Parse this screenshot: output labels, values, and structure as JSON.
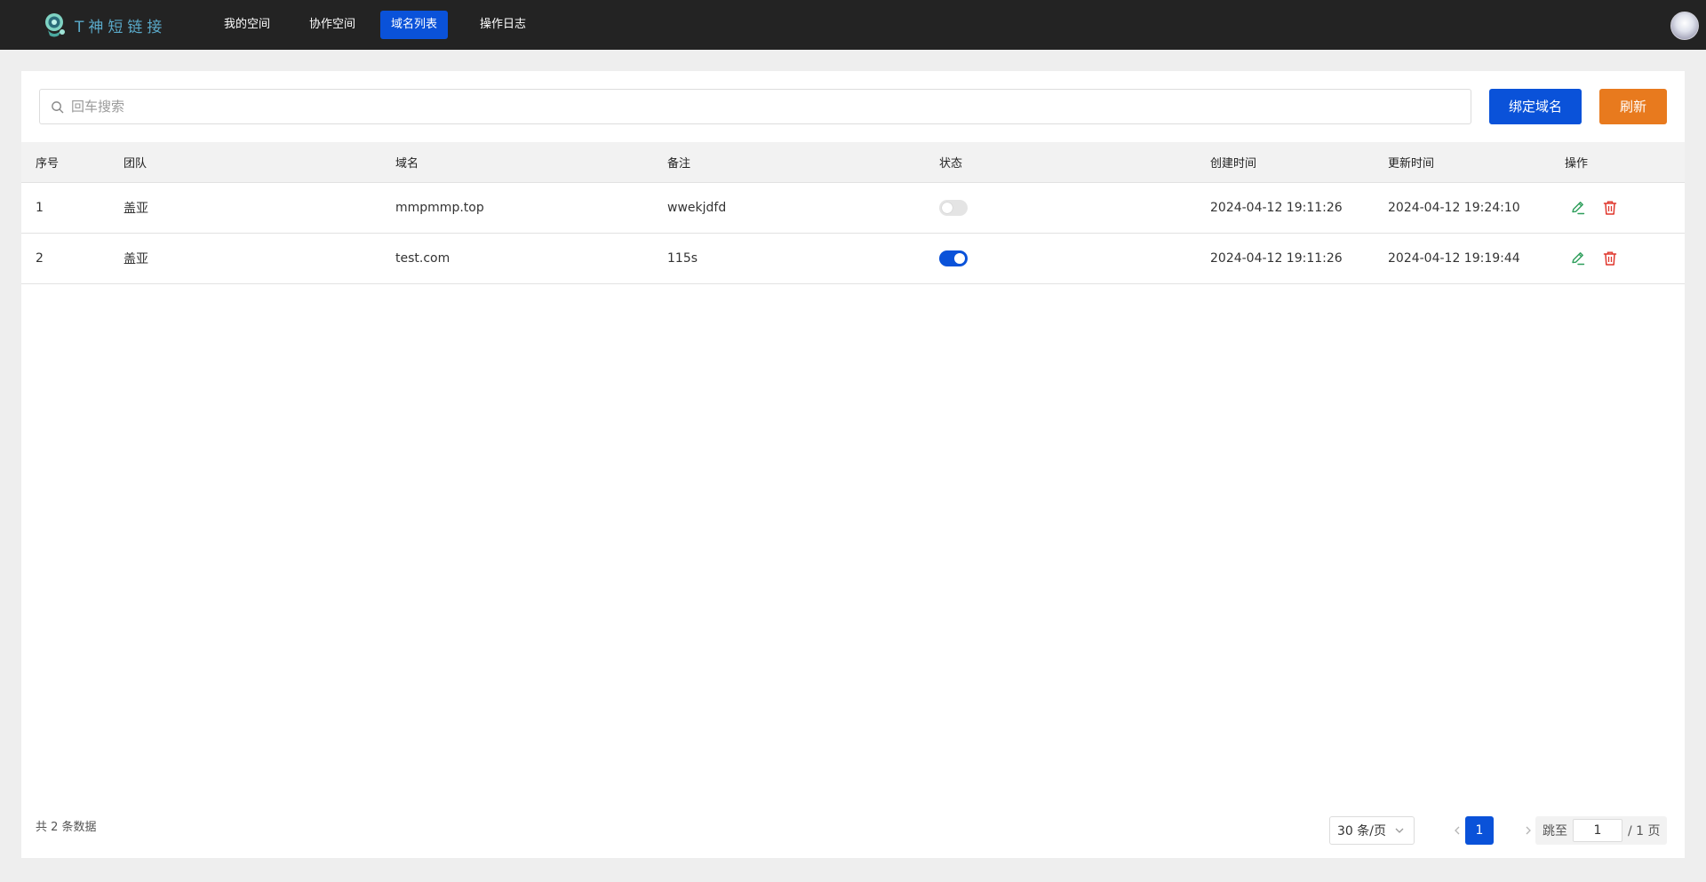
{
  "app": {
    "logo_text": "T神短链接"
  },
  "nav": {
    "items": [
      {
        "label": "我的空间"
      },
      {
        "label": "协作空间"
      },
      {
        "label": "域名列表",
        "active": true
      },
      {
        "label": "操作日志"
      }
    ]
  },
  "search": {
    "placeholder": "回车搜索",
    "value": ""
  },
  "toolbar": {
    "bind_label": "绑定域名",
    "refresh_label": "刷新"
  },
  "table": {
    "headers": [
      "序号",
      "团队",
      "域名",
      "备注",
      "状态",
      "创建时间",
      "更新时间",
      "操作"
    ],
    "rows": [
      {
        "index": "1",
        "team": "盖亚",
        "domain": "mmpmmp.top",
        "note": "wwekjdfd",
        "status_on": false,
        "created": "2024-04-12 19:11:26",
        "updated": "2024-04-12 19:24:10"
      },
      {
        "index": "2",
        "team": "盖亚",
        "domain": "test.com",
        "note": "115s",
        "status_on": true,
        "created": "2024-04-12 19:11:26",
        "updated": "2024-04-12 19:19:44"
      }
    ]
  },
  "pagination": {
    "total_text": "共 2 条数据",
    "page_size": "30 条/页",
    "current_page": "1",
    "jump_label": "跳至",
    "jump_value": "1",
    "total_pages_text": "/ 1 页"
  },
  "colors": {
    "primary": "#0a52d9",
    "refresh": "#e87a1e",
    "edit_icon": "#2e9e5b",
    "delete_icon": "#e0362c",
    "topbar": "#232323"
  },
  "icons": {
    "search": "search-icon",
    "edit": "edit-icon",
    "delete": "trash-icon",
    "prev": "chevron-left-icon",
    "next": "chevron-right-icon",
    "dropdown": "chevron-down-icon"
  }
}
